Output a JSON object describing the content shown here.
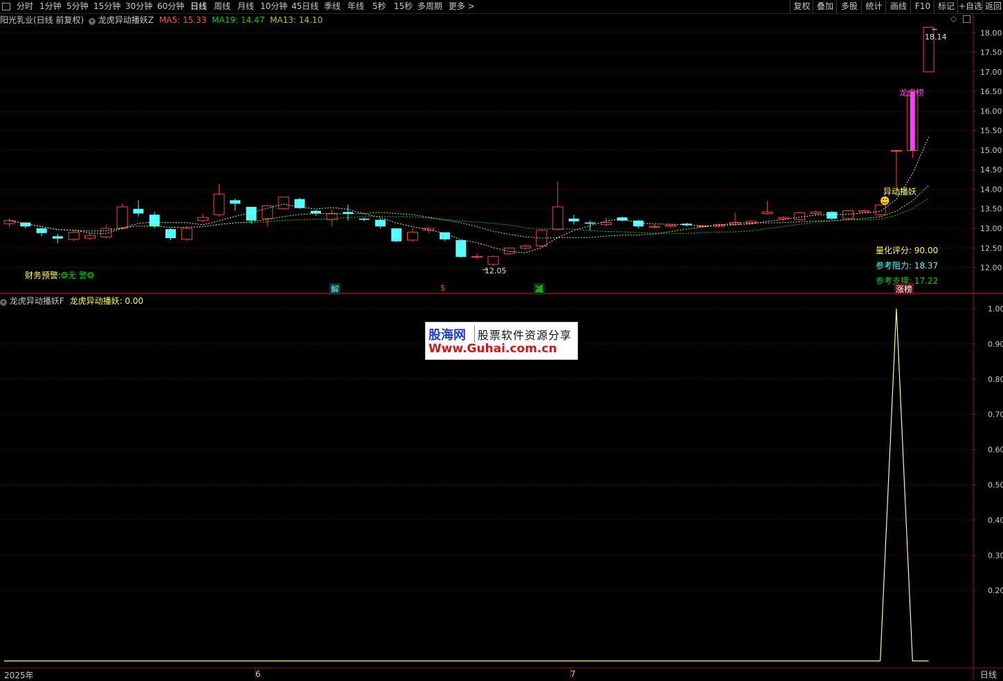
{
  "toolbar": {
    "periods": [
      "分时",
      "1分钟",
      "5分钟",
      "15分钟",
      "30分钟",
      "60分钟",
      "日线",
      "周线",
      "月线",
      "10分钟",
      "45日线",
      "季线",
      "年线",
      "5秒",
      "15秒",
      "多周期",
      "更多 >"
    ],
    "active_period": "日线",
    "right_buttons": [
      "复权",
      "叠加",
      "多股",
      "统计",
      "画线",
      "F10",
      "标记",
      "+自选",
      "返回"
    ]
  },
  "main_panel": {
    "stock_title": "阳光乳业(日线 前复权)",
    "indicator_name": "龙虎异动播妖Z",
    "ma5": "MA5: 15.33",
    "ma19": "MA19: 14.47",
    "ma13": "MA13: 14.10",
    "finance_warning_label": "财务预警:",
    "finance_warning_value": "❂无 警❂",
    "high_label": "18.14",
    "low_label": "12.05",
    "longhu_label": "龙虎榜",
    "yidong_label": "异动播妖",
    "score_label": "量化评分:",
    "score_value": "90.00",
    "resistance_label": "参考阻力:",
    "resistance_value": "18.37",
    "support_label": "参考支撑:",
    "support_value": "17.22",
    "marker_jie": "解",
    "marker_s": "$",
    "marker_jian": "减",
    "marker_zhangbang": "涨榜",
    "y_axis_ticks": [
      "18.00",
      "17.50",
      "17.00",
      "16.50",
      "16.00",
      "15.50",
      "15.00",
      "14.50",
      "14.00",
      "13.50",
      "13.00",
      "12.50",
      "12.00"
    ]
  },
  "sub_panel": {
    "indicator_name": "龙虎异动播妖F",
    "value_label": "龙虎异动播妖: 0.00",
    "y_axis_ticks": [
      "1.00",
      "0.90",
      "0.80",
      "0.70",
      "0.60",
      "0.50",
      "0.40",
      "0.30",
      "0.20"
    ]
  },
  "x_axis": {
    "labels": [
      "2025年",
      "6",
      "7"
    ],
    "period_label": "日线"
  },
  "watermark": {
    "brand": "股海网",
    "slogan": "股票软件资源分享",
    "url": "Www.Guhai.com.cn"
  },
  "colors": {
    "up": "#ff4040",
    "down": "#54ffff",
    "ma5": "#e0e0e0",
    "ma19": "#00d000",
    "ma13": "#e0e000",
    "magenta": "#ff3cff",
    "axis_red": "#a01010"
  },
  "chart_data": {
    "type": "candlestick",
    "price_range": [
      11.7,
      18.4
    ],
    "candles": [
      [
        13.12,
        13.2,
        13.26,
        13.03
      ],
      [
        13.15,
        13.05,
        13.1,
        13.0
      ],
      [
        13.0,
        12.88,
        13.02,
        12.8
      ],
      [
        12.8,
        12.74,
        12.86,
        12.62
      ],
      [
        12.72,
        12.9,
        12.95,
        12.68
      ],
      [
        12.75,
        12.82,
        12.88,
        12.7
      ],
      [
        12.78,
        13.0,
        13.1,
        12.75
      ],
      [
        13.0,
        13.55,
        13.63,
        12.97
      ],
      [
        13.5,
        13.38,
        13.72,
        13.3
      ],
      [
        13.35,
        13.05,
        13.42,
        13.0
      ],
      [
        12.98,
        12.75,
        13.0,
        12.7
      ],
      [
        12.72,
        13.0,
        13.05,
        12.68
      ],
      [
        13.2,
        13.28,
        13.38,
        13.15
      ],
      [
        13.35,
        13.88,
        14.13,
        13.3
      ],
      [
        13.72,
        13.63,
        13.76,
        13.45
      ],
      [
        13.55,
        13.2,
        13.55,
        13.12
      ],
      [
        13.25,
        13.58,
        13.6,
        13.05
      ],
      [
        13.5,
        13.8,
        13.8,
        13.48
      ],
      [
        13.75,
        13.52,
        13.78,
        13.5
      ],
      [
        13.45,
        13.38,
        13.47,
        13.32
      ],
      [
        13.22,
        13.38,
        13.48,
        13.05
      ],
      [
        13.42,
        13.37,
        13.6,
        13.2
      ],
      [
        13.25,
        13.22,
        13.28,
        13.18
      ],
      [
        13.22,
        13.05,
        13.25,
        13.0
      ],
      [
        13.0,
        12.67,
        13.0,
        12.65
      ],
      [
        12.7,
        12.9,
        13.0,
        12.65
      ],
      [
        12.95,
        13.0,
        13.05,
        12.88
      ],
      [
        12.9,
        12.72,
        12.9,
        12.68
      ],
      [
        12.7,
        12.27,
        12.7,
        12.25
      ],
      [
        12.28,
        12.28,
        12.36,
        12.2
      ],
      [
        12.08,
        12.28,
        12.3,
        12.05
      ],
      [
        12.35,
        12.5,
        12.52,
        12.32
      ],
      [
        12.5,
        12.55,
        12.6,
        12.45
      ],
      [
        12.55,
        12.95,
        12.98,
        12.52
      ],
      [
        12.97,
        13.55,
        14.2,
        12.95
      ],
      [
        13.25,
        13.18,
        13.35,
        13.1
      ],
      [
        13.15,
        13.12,
        13.2,
        12.95
      ],
      [
        13.1,
        13.15,
        13.28,
        13.05
      ],
      [
        13.28,
        13.2,
        13.3,
        13.18
      ],
      [
        13.2,
        13.05,
        13.22,
        13.0
      ],
      [
        13.05,
        13.05,
        13.1,
        13.0
      ],
      [
        13.05,
        13.08,
        13.1,
        13.02
      ],
      [
        13.12,
        13.08,
        13.15,
        13.05
      ],
      [
        13.05,
        13.06,
        13.08,
        13.03
      ],
      [
        13.05,
        13.1,
        13.12,
        13.03
      ],
      [
        13.1,
        13.15,
        13.4,
        13.07
      ],
      [
        13.13,
        13.18,
        13.2,
        13.1
      ],
      [
        13.38,
        13.42,
        13.7,
        13.35
      ],
      [
        13.25,
        13.28,
        13.32,
        13.2
      ],
      [
        13.22,
        13.4,
        13.42,
        13.2
      ],
      [
        13.38,
        13.42,
        13.45,
        13.35
      ],
      [
        13.42,
        13.25,
        13.45,
        13.22
      ],
      [
        13.25,
        13.45,
        13.47,
        13.22
      ],
      [
        13.42,
        13.45,
        13.48,
        13.4
      ],
      [
        13.35,
        13.6,
        13.62,
        13.3
      ],
      [
        14.99,
        14.99,
        14.99,
        13.95
      ],
      [
        14.99,
        16.49,
        16.49,
        14.8
      ],
      [
        17.0,
        18.14,
        18.14,
        17.0
      ]
    ],
    "sub_series": {
      "values": [
        0,
        0,
        0,
        0,
        0,
        0,
        0,
        0,
        0,
        0,
        0,
        0,
        0,
        0,
        0,
        0,
        0,
        0,
        0,
        0,
        0,
        0,
        0,
        0,
        0,
        0,
        0,
        0,
        0,
        0,
        0,
        0,
        0,
        0,
        0,
        0,
        0,
        0,
        0,
        0,
        0,
        0,
        0,
        0,
        0,
        0,
        0,
        0,
        0,
        0,
        0,
        0,
        0,
        0,
        0,
        1,
        0,
        0
      ],
      "ylim": [
        0,
        1.0
      ]
    }
  }
}
